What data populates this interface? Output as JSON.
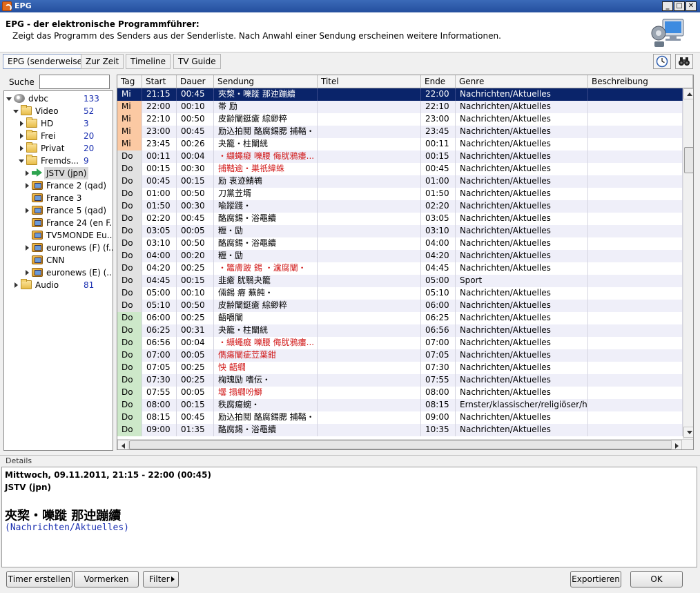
{
  "window": {
    "title": "EPG"
  },
  "header": {
    "title": "EPG - der elektronische Programmführer:",
    "subtitle": "Zeigt das Programm des Senders aus der Senderliste. Nach Anwahl einer Sendung erscheinen weitere Informationen."
  },
  "tabs": [
    {
      "label": "EPG (senderweise)",
      "active": true
    },
    {
      "label": "Zur Zeit",
      "active": false
    },
    {
      "label": "Timeline",
      "active": false
    },
    {
      "label": "TV Guide",
      "active": false
    }
  ],
  "toolbar": {
    "clock_icon": "clock-icon",
    "binoculars_icon": "binoculars-icon"
  },
  "search": {
    "label": "Suche",
    "value": ""
  },
  "tree": [
    {
      "label": "dvbc",
      "count": "133",
      "level": 0,
      "icon": "satellite",
      "expanded": true
    },
    {
      "label": "Video",
      "count": "52",
      "level": 1,
      "icon": "folder",
      "expanded": true
    },
    {
      "label": "HD",
      "count": "3",
      "level": 2,
      "icon": "folder",
      "expanded": false
    },
    {
      "label": "Frei",
      "count": "20",
      "level": 2,
      "icon": "folder",
      "expanded": false
    },
    {
      "label": "Privat",
      "count": "20",
      "level": 2,
      "icon": "folder",
      "expanded": false
    },
    {
      "label": "Fremds...",
      "count": "9",
      "level": 2,
      "icon": "folder",
      "expanded": true
    },
    {
      "label": "JSTV (jpn)",
      "count": "",
      "level": 3,
      "icon": "greenarrow",
      "expanded": false,
      "selected": true
    },
    {
      "label": "France 2 (qad)",
      "count": "",
      "level": 3,
      "icon": "tv",
      "expanded": false
    },
    {
      "label": "France 3",
      "count": "",
      "level": 3,
      "icon": "tv",
      "expanded": null
    },
    {
      "label": "France 5 (qad)",
      "count": "",
      "level": 3,
      "icon": "tv",
      "expanded": false
    },
    {
      "label": "France 24 (en F...",
      "count": "",
      "level": 3,
      "icon": "tv",
      "expanded": null
    },
    {
      "label": "TV5MONDE Eu...",
      "count": "",
      "level": 3,
      "icon": "tv",
      "expanded": null
    },
    {
      "label": "euronews (F) (f...",
      "count": "",
      "level": 3,
      "icon": "tv",
      "expanded": false
    },
    {
      "label": "CNN",
      "count": "",
      "level": 3,
      "icon": "tv",
      "expanded": null
    },
    {
      "label": "euronews (E) (...",
      "count": "",
      "level": 3,
      "icon": "tv",
      "expanded": false
    },
    {
      "label": "Audio",
      "count": "81",
      "level": 1,
      "icon": "folder",
      "expanded": false
    }
  ],
  "grid": {
    "columns": [
      "Tag",
      "Start",
      "Dauer",
      "Sendung",
      "Titel",
      "Ende",
      "Genre",
      "Beschreibung"
    ],
    "rows": [
      {
        "tag": "Mi",
        "start": "21:15",
        "dauer": "00:45",
        "sendung": "夾棃・嚛蹝 那迚蹦續",
        "ende": "22:00",
        "genre": "Nachrichten/Aktuelles",
        "red": false,
        "selected": true,
        "shade": "mi"
      },
      {
        "tag": "Mi",
        "start": "22:00",
        "dauer": "00:10",
        "sendung": "帯 励",
        "ende": "22:10",
        "genre": "Nachrichten/Aktuelles",
        "red": false,
        "shade": "mi"
      },
      {
        "tag": "Mi",
        "start": "22:10",
        "dauer": "00:50",
        "sendung": "皮齢闡鋌瘡 綜緲粹",
        "ende": "23:00",
        "genre": "Nachrichten/Aktuelles",
        "red": false,
        "shade": "mi"
      },
      {
        "tag": "Mi",
        "start": "23:00",
        "dauer": "00:45",
        "sendung": "励込拍鬩 酪腐錫腮 捕鞜・",
        "ende": "23:45",
        "genre": "Nachrichten/Aktuelles",
        "red": false,
        "shade": "mi"
      },
      {
        "tag": "Mi",
        "start": "23:45",
        "dauer": "00:26",
        "sendung": "夬籠・柱闡絖",
        "ende": "00:11",
        "genre": "Nachrichten/Aktuelles",
        "red": false,
        "shade": "mi"
      },
      {
        "tag": "Do",
        "start": "00:11",
        "dauer": "00:04",
        "sendung": "・纈蠅癡 嚛腰 侮肬鴉瘻...",
        "ende": "00:15",
        "genre": "Nachrichten/Aktuelles",
        "red": true,
        "shade": "do0"
      },
      {
        "tag": "Do",
        "start": "00:15",
        "dauer": "00:30",
        "sendung": "捕鞜逾・巣祇緯蛛",
        "ende": "00:45",
        "genre": "Nachrichten/Aktuelles",
        "red": true,
        "shade": "do0"
      },
      {
        "tag": "Do",
        "start": "00:45",
        "dauer": "00:15",
        "sendung": "励 衷迹鯖鴾",
        "ende": "01:00",
        "genre": "Nachrichten/Aktuelles",
        "red": false,
        "shade": "do0"
      },
      {
        "tag": "Do",
        "start": "01:00",
        "dauer": "00:50",
        "sendung": "刀黨苙壻",
        "ende": "01:50",
        "genre": "Nachrichten/Aktuelles",
        "red": false,
        "shade": "do0"
      },
      {
        "tag": "Do",
        "start": "01:50",
        "dauer": "00:30",
        "sendung": "喩蹤踐・",
        "ende": "02:20",
        "genre": "Nachrichten/Aktuelles",
        "red": false,
        "shade": "do0"
      },
      {
        "tag": "Do",
        "start": "02:20",
        "dauer": "00:45",
        "sendung": "酪腐錫・浴黽續",
        "ende": "03:05",
        "genre": "Nachrichten/Aktuelles",
        "red": false,
        "shade": "do0"
      },
      {
        "tag": "Do",
        "start": "03:05",
        "dauer": "00:05",
        "sendung": "糎・励",
        "ende": "03:10",
        "genre": "Nachrichten/Aktuelles",
        "red": false,
        "shade": "do0"
      },
      {
        "tag": "Do",
        "start": "03:10",
        "dauer": "00:50",
        "sendung": "酪腐錫・浴黽續",
        "ende": "04:00",
        "genre": "Nachrichten/Aktuelles",
        "red": false,
        "shade": "do0"
      },
      {
        "tag": "Do",
        "start": "04:00",
        "dauer": "00:20",
        "sendung": "糎・励",
        "ende": "04:20",
        "genre": "Nachrichten/Aktuelles",
        "red": false,
        "shade": "do0"
      },
      {
        "tag": "Do",
        "start": "04:20",
        "dauer": "00:25",
        "sendung": "・鼈膚跛 錫 ・瀘腐闡・",
        "ende": "04:45",
        "genre": "Nachrichten/Aktuelles",
        "red": true,
        "shade": "do0"
      },
      {
        "tag": "Do",
        "start": "04:45",
        "dauer": "00:15",
        "sendung": "韭瘡 肬翳夬籠",
        "ende": "05:00",
        "genre": "Sport",
        "red": false,
        "shade": "do0"
      },
      {
        "tag": "Do",
        "start": "05:00",
        "dauer": "00:10",
        "sendung": "倆錫 瘠 蕪飩・",
        "ende": "05:10",
        "genre": "Nachrichten/Aktuelles",
        "red": false,
        "shade": "do0"
      },
      {
        "tag": "Do",
        "start": "05:10",
        "dauer": "00:50",
        "sendung": "皮齢闡鋌瘡 綜緲粹",
        "ende": "06:00",
        "genre": "Nachrichten/Aktuelles",
        "red": false,
        "shade": "do0"
      },
      {
        "tag": "Do",
        "start": "06:00",
        "dauer": "00:25",
        "sendung": "齬嚼闡",
        "ende": "06:25",
        "genre": "Nachrichten/Aktuelles",
        "red": false,
        "shade": "do1"
      },
      {
        "tag": "Do",
        "start": "06:25",
        "dauer": "00:31",
        "sendung": "夬籠・柱闡絖",
        "ende": "06:56",
        "genre": "Nachrichten/Aktuelles",
        "red": false,
        "shade": "do1"
      },
      {
        "tag": "Do",
        "start": "06:56",
        "dauer": "00:04",
        "sendung": "・纈蠅癡 嚛腰 侮肬鴉瘻...",
        "ende": "07:00",
        "genre": "Nachrichten/Aktuelles",
        "red": true,
        "shade": "do1"
      },
      {
        "tag": "Do",
        "start": "07:00",
        "dauer": "00:05",
        "sendung": "儁瘍闡疵苙葉鉗",
        "ende": "07:05",
        "genre": "Nachrichten/Aktuelles",
        "red": true,
        "shade": "do1"
      },
      {
        "tag": "Do",
        "start": "07:05",
        "dauer": "00:25",
        "sendung": "怏 齬繝",
        "ende": "07:30",
        "genre": "Nachrichten/Aktuelles",
        "red": true,
        "shade": "do1"
      },
      {
        "tag": "Do",
        "start": "07:30",
        "dauer": "00:25",
        "sendung": "椈瑰励 嗜伝・",
        "ende": "07:55",
        "genre": "Nachrichten/Aktuelles",
        "red": false,
        "shade": "do1"
      },
      {
        "tag": "Do",
        "start": "07:55",
        "dauer": "00:05",
        "sendung": "壜 搨繝吩鰤",
        "ende": "08:00",
        "genre": "Nachrichten/Aktuelles",
        "red": true,
        "shade": "do1"
      },
      {
        "tag": "Do",
        "start": "08:00",
        "dauer": "00:15",
        "sendung": "秩腐瘍蜿・",
        "ende": "08:15",
        "genre": "Ernster/klassischer/religiöser/his...",
        "red": false,
        "shade": "do1"
      },
      {
        "tag": "Do",
        "start": "08:15",
        "dauer": "00:45",
        "sendung": "励込拍鬩 酪腐錫腮 捕鞜・",
        "ende": "09:00",
        "genre": "Nachrichten/Aktuelles",
        "red": false,
        "shade": "do1"
      },
      {
        "tag": "Do",
        "start": "09:00",
        "dauer": "01:35",
        "sendung": "酪腐錫・浴黽續",
        "ende": "10:35",
        "genre": "Nachrichten/Aktuelles",
        "red": false,
        "shade": "do1"
      }
    ]
  },
  "details": {
    "legend": "Details",
    "date": "Mittwoch, 09.11.2011, 21:15 - 22:00  (00:45)",
    "sender": "JSTV (jpn)",
    "title": "夾棃・嚛蹝 那迚蹦續",
    "genre": "(Nachrichten/Aktuelles)"
  },
  "buttons": {
    "timer": "Timer erstellen",
    "vormerken": "Vormerken",
    "filter": "Filter",
    "export": "Exportieren",
    "ok": "OK"
  },
  "colors": {
    "selection": "#0a246a",
    "day_mi": "#fbc9a3",
    "day_do_night": "#e2e2e2",
    "day_do_morning": "#cde8c9",
    "red_text": "#d11a1a",
    "count_blue": "#1a2fb0"
  }
}
